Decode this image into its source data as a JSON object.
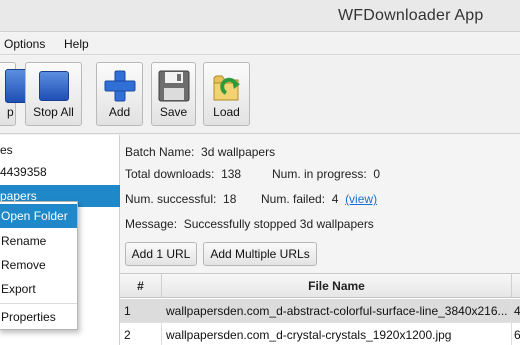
{
  "app": {
    "title": "WFDownloader App"
  },
  "menu": {
    "options": "Options",
    "help": "Help"
  },
  "toolbar": {
    "partial_label": "p",
    "stop_all": "Stop All",
    "add": "Add",
    "save": "Save",
    "load": "Load"
  },
  "sidebar": {
    "items": [
      {
        "label": "es"
      },
      {
        "label": "4439358"
      },
      {
        "label": "papers"
      }
    ]
  },
  "context_menu": {
    "items": [
      "Open Folder",
      "Rename",
      "Remove",
      "Export",
      "Properties"
    ]
  },
  "batch": {
    "name_label": "Batch Name:",
    "name": "3d wallpapers",
    "total_label": "Total downloads:",
    "total": "138",
    "progress_label": "Num. in progress:",
    "progress": "0",
    "success_label": "Num. successful:",
    "success": "18",
    "failed_label": "Num. failed:",
    "failed": "4",
    "view_link": "(view)",
    "message_label": "Message:",
    "message": "Successfully stopped 3d wallpapers"
  },
  "buttons": {
    "add_one": "Add 1 URL",
    "add_multiple": "Add Multiple URLs"
  },
  "table": {
    "headers": [
      "#",
      "File Name"
    ],
    "rows": [
      {
        "num": "1",
        "file": "wallpapersden.com_d-abstract-colorful-surface-line_3840x216...",
        "extra": "4"
      },
      {
        "num": "2",
        "file": "wallpapersden.com_d-crystal-crystals_1920x1200.jpg",
        "extra": "6"
      }
    ]
  },
  "colors": {
    "selection": "#1e88c9",
    "link": "#1a6fd0"
  }
}
